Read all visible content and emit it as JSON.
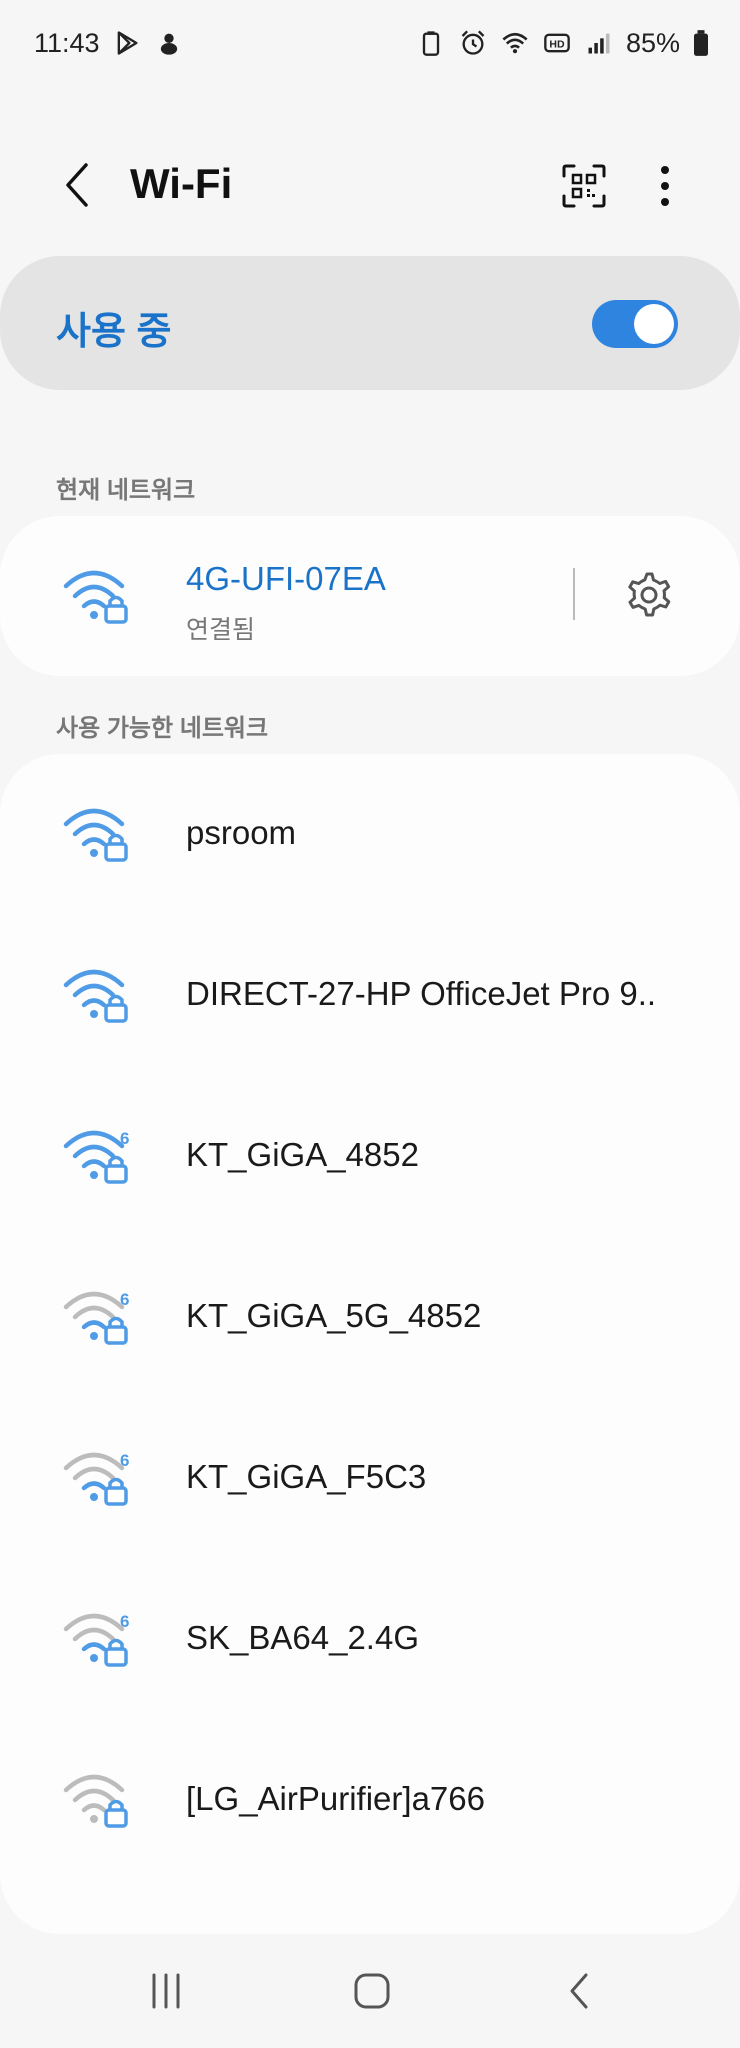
{
  "status_bar": {
    "time": "11:43",
    "battery_percent": "85%"
  },
  "header": {
    "title": "Wi-Fi"
  },
  "master_switch": {
    "label": "사용 중",
    "on": true
  },
  "sections": {
    "current": "현재 네트워크",
    "available": "사용 가능한 네트워크"
  },
  "current_network": {
    "name": "4G-UFI-07EA",
    "status": "연결됨"
  },
  "networks": [
    {
      "name": "psroom",
      "wifi6": false
    },
    {
      "name": "DIRECT-27-HP OfficeJet Pro 9..",
      "wifi6": false
    },
    {
      "name": "KT_GiGA_4852",
      "wifi6": true
    },
    {
      "name": "KT_GiGA_5G_4852",
      "wifi6": true
    },
    {
      "name": "KT_GiGA_F5C3",
      "wifi6": true
    },
    {
      "name": "SK_BA64_2.4G",
      "wifi6": true
    },
    {
      "name": "[LG_AirPurifier]a766",
      "wifi6": false
    }
  ],
  "colors": {
    "accent": "#1b73c9",
    "wifi_icon": "#4f9be6",
    "wifi_icon_dim": "#bcbcbc"
  }
}
